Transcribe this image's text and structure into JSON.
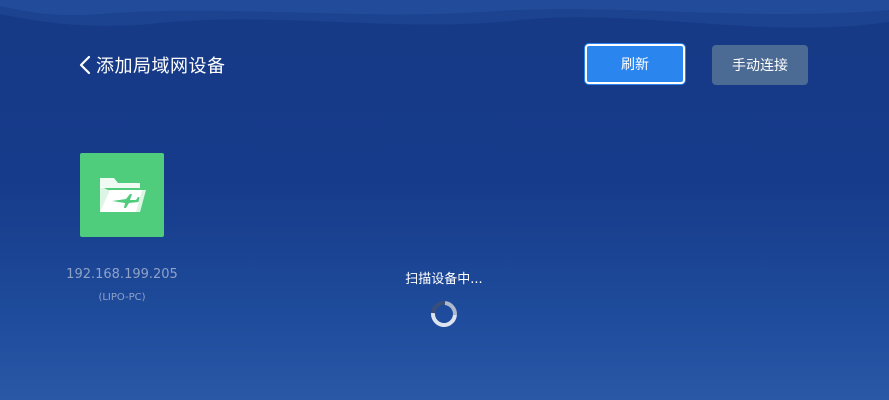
{
  "header": {
    "back_icon": "chevron-left-icon",
    "title": "添加局域网设备",
    "refresh_label": "刷新",
    "manual_connect_label": "手动连接"
  },
  "devices": [
    {
      "icon": "folder-plane-icon",
      "ip": "192.168.199.205",
      "name": "(LIPO-PC)"
    }
  ],
  "scan": {
    "status_text": "扫描设备中..."
  },
  "colors": {
    "background": "#173a86",
    "refresh_button": "#2a86ee",
    "manual_button": "#4c6b94",
    "device_tile": "#4fcd7d",
    "muted_text": "#8fa2c8"
  }
}
